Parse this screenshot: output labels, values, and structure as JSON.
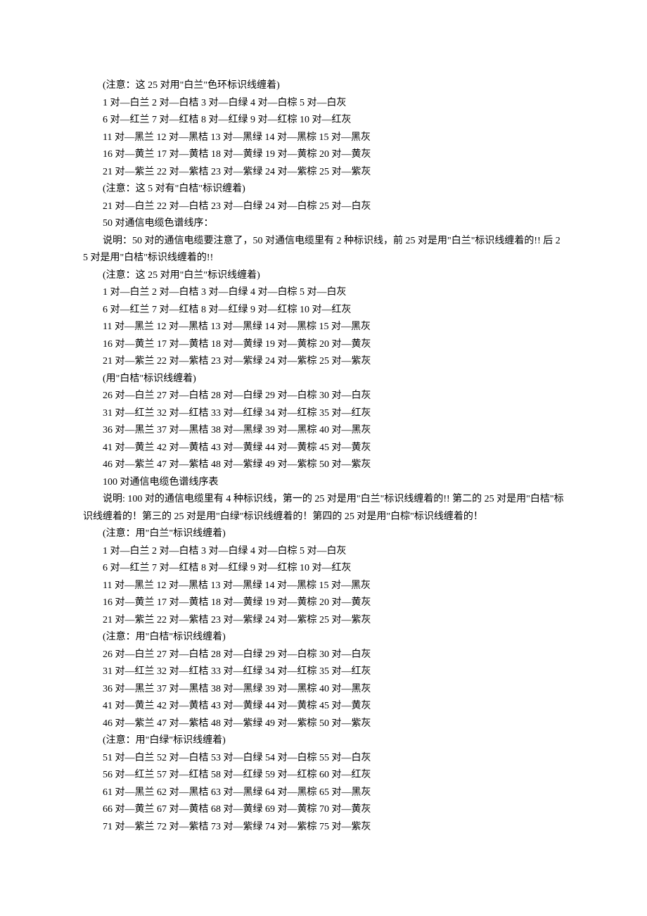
{
  "lines": [
    "(注意：这 25 对用\"白兰\"色环标识线缠着)",
    "1 对—白兰 2 对—白桔 3 对—白绿 4 对—白棕 5 对—白灰",
    "6 对—红兰 7 对—红桔 8 对—红绿 9 对—红棕 10 对—红灰",
    "11 对—黑兰 12 对—黑桔 13 对—黑绿 14 对—黑棕 15 对—黑灰",
    "16 对—黄兰 17 对—黄桔 18 对—黄绿 19 对—黄棕 20 对—黄灰",
    "21 对—紫兰 22 对—紫桔 23 对—紫绿 24 对—紫棕 25 对—紫灰",
    "(注意：这 5 对有\"白桔\"标识缠着)",
    "21 对—白兰 22 对—白桔 23 对—白绿 24 对—白棕 25 对—白灰",
    "50 对通信电缆色谱线序：",
    "说明：50 对的通信电缆要注意了，50 对通信电缆里有 2 种标识线，前 25 对是用\"白兰\"标识线缠着的!! 后 25 对是用\"白桔\"标识线缠着的!!",
    "(注意：这 25 对用\"白兰\"标识线缠着)",
    "1 对—白兰 2 对—白桔 3 对—白绿 4 对—白棕 5 对—白灰",
    "6 对—红兰 7 对—红桔 8 对—红绿 9 对—红棕 10 对—红灰",
    "11 对—黑兰 12 对—黑桔 13 对—黑绿 14 对—黑棕 15 对—黑灰",
    "16 对—黄兰 17 对—黄桔 18 对—黄绿 19 对—黄棕 20 对—黄灰",
    "21 对—紫兰 22 对—紫桔 23 对—紫绿 24 对—紫棕 25 对—紫灰",
    "(用\"白桔\"标识线缠着)",
    "26 对—白兰 27 对—白桔 28 对—白绿 29 对—白棕 30 对—白灰",
    "31 对—红兰 32 对—红桔 33 对—红绿 34 对—红棕 35 对—红灰",
    "36 对—黑兰 37 对—黑桔 38 对—黑绿 39 对—黑棕 40 对—黑灰",
    "41 对—黄兰 42 对—黄桔 43 对—黄绿 44 对—黄棕 45 对—黄灰",
    "46 对—紫兰 47 对—紫桔 48 对—紫绿 49 对—紫棕 50 对—紫灰",
    "100 对通信电缆色谱线序表",
    "说明: 100 对的通信电缆里有 4 种标识线，第一的 25 对是用\"白兰\"标识线缠着的!! 第二的 25 对是用\"白桔\"标识线缠着的！第三的 25 对是用\"白绿\"标识线缠着的！第四的 25 对是用\"白棕\"标识线缠着的！",
    "(注意：用\"白兰\"标识线缠着)",
    "1 对—白兰 2 对—白桔 3 对—白绿 4 对—白棕 5 对—白灰",
    "6 对—红兰 7 对—红桔 8 对—红绿 9 对—红棕 10 对—红灰",
    "11 对—黑兰 12 对—黑桔 13 对—黑绿 14 对—黑棕 15 对—黑灰",
    "16 对—黄兰 17 对—黄桔 18 对—黄绿 19 对—黄棕 20 对—黄灰",
    "21 对—紫兰 22 对—紫桔 23 对—紫绿 24 对—紫棕 25 对—紫灰",
    "(注意：用\"白桔\"标识线缠着)",
    "26 对—白兰 27 对—白桔 28 对—白绿 29 对—白棕 30 对—白灰",
    "31 对—红兰 32 对—红桔 33 对—红绿 34 对—红棕 35 对—红灰",
    "36 对—黑兰 37 对—黑桔 38 对—黑绿 39 对—黑棕 40 对—黑灰",
    "41 对—黄兰 42 对—黄桔 43 对—黄绿 44 对—黄棕 45 对—黄灰",
    "46 对—紫兰 47 对—紫桔 48 对—紫绿 49 对—紫棕 50 对—紫灰",
    "(注意：用\"白绿\"标识线缠着)",
    "51 对—白兰 52 对—白桔 53 对—白绿 54 对—白棕 55 对—白灰",
    "56 对—红兰 57 对—红桔 58 对—红绿 59 对—红棕 60 对—红灰",
    "61 对—黑兰 62 对—黑桔 63 对—黑绿 64 对—黑棕 65 对—黑灰",
    "66 对—黄兰 67 对—黄桔 68 对—黄绿 69 对—黄棕 70 对—黄灰",
    "71 对—紫兰 72 对—紫桔 73 对—紫绿 74 对—紫棕 75 对—紫灰"
  ]
}
